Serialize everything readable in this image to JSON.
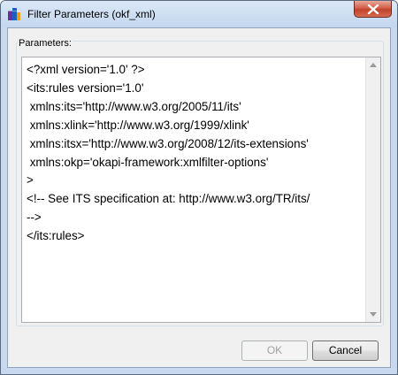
{
  "window": {
    "title": "Filter Parameters (okf_xml)",
    "app_icon": "okapi-app-icon",
    "close_icon": "close-icon"
  },
  "parameters": {
    "label": "Parameters:",
    "lines": [
      "<?xml version='1.0' ?>",
      "<its:rules version='1.0'",
      " xmlns:its='http://www.w3.org/2005/11/its'",
      " xmlns:xlink='http://www.w3.org/1999/xlink'",
      " xmlns:itsx='http://www.w3.org/2008/12/its-extensions'",
      " xmlns:okp='okapi-framework:xmlfilter-options'",
      ">",
      "<!-- See ITS specification at: http://www.w3.org/TR/its/",
      "-->",
      "</its:rules>"
    ]
  },
  "buttons": {
    "ok_label": "OK",
    "ok_enabled": false,
    "cancel_label": "Cancel"
  },
  "colors": {
    "window_frame": "#c6d9ef",
    "close_button": "#c8462e",
    "dialog_background": "#f0f0f0"
  }
}
